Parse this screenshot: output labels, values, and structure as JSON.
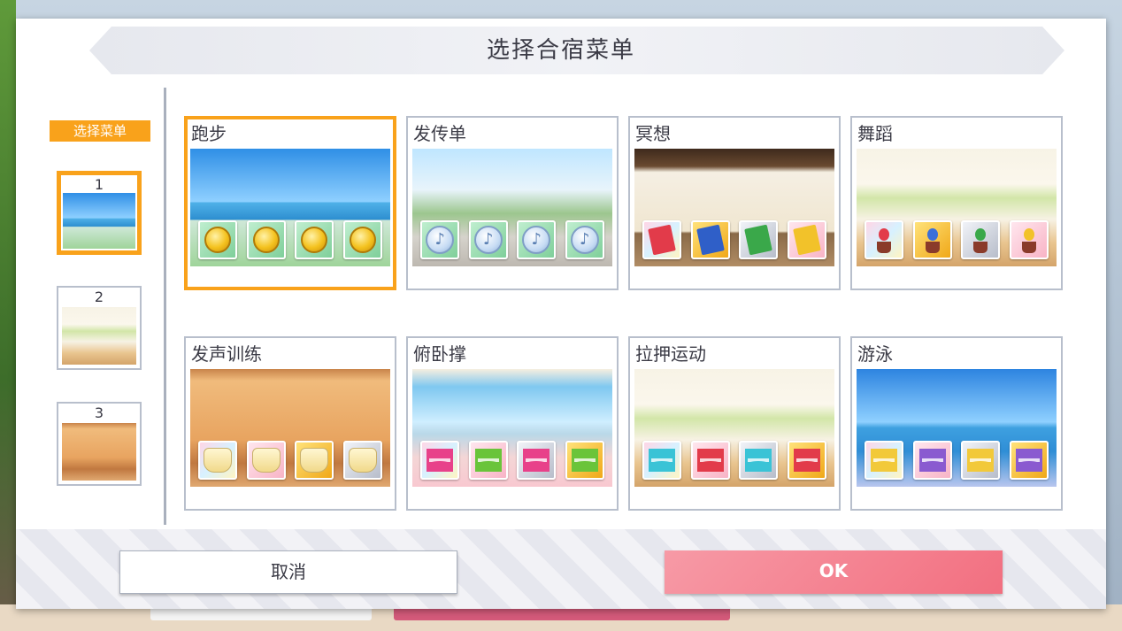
{
  "dialog": {
    "title": "选择合宿菜单",
    "tag_label": "选择菜单",
    "cancel_label": "取消",
    "ok_label": "OK"
  },
  "slots": [
    {
      "number": "1",
      "selected": true
    },
    {
      "number": "2",
      "selected": false
    },
    {
      "number": "3",
      "selected": false
    }
  ],
  "menus": [
    {
      "name": "跑步",
      "selected": true,
      "scene": "beach",
      "items": [
        "gold-coin-icon",
        "gold-coin-icon",
        "gold-coin-icon",
        "gold-coin-icon"
      ]
    },
    {
      "name": "发传单",
      "selected": false,
      "scene": "town",
      "items": [
        "music-note-badge-icon",
        "music-note-badge-icon",
        "music-note-badge-icon",
        "music-note-badge-icon"
      ]
    },
    {
      "name": "冥想",
      "selected": false,
      "scene": "dojo",
      "items": [
        "red-book-icon",
        "blue-book-icon",
        "green-book-icon",
        "yellow-book-icon"
      ]
    },
    {
      "name": "舞蹈",
      "selected": false,
      "scene": "studio",
      "items": [
        "red-flower-pot-icon",
        "blue-flower-pot-icon",
        "sprout-pot-icon",
        "yellow-flower-box-icon"
      ]
    },
    {
      "name": "发声训练",
      "selected": false,
      "scene": "music-room",
      "items": [
        "pudding-icon",
        "pudding-icon",
        "pudding-icon",
        "pudding-icon"
      ]
    },
    {
      "name": "俯卧撑",
      "selected": false,
      "scene": "gym",
      "items": [
        "pink-macaron-icon",
        "green-macaron-icon",
        "pink-macaron-icon",
        "green-macaron-icon"
      ]
    },
    {
      "name": "拉押运动",
      "selected": false,
      "scene": "studio",
      "items": [
        "blue-macaron-icon",
        "red-macaron-icon",
        "blue-macaron-icon",
        "red-macaron-icon"
      ]
    },
    {
      "name": "游泳",
      "selected": false,
      "scene": "pool",
      "items": [
        "yellow-macaron-icon",
        "purple-macaron-icon",
        "yellow-macaron-icon",
        "purple-macaron-icon"
      ]
    }
  ],
  "colors": {
    "selection": "#f9a21b",
    "ok_button": "#f26f80",
    "text": "#3b3b46"
  }
}
